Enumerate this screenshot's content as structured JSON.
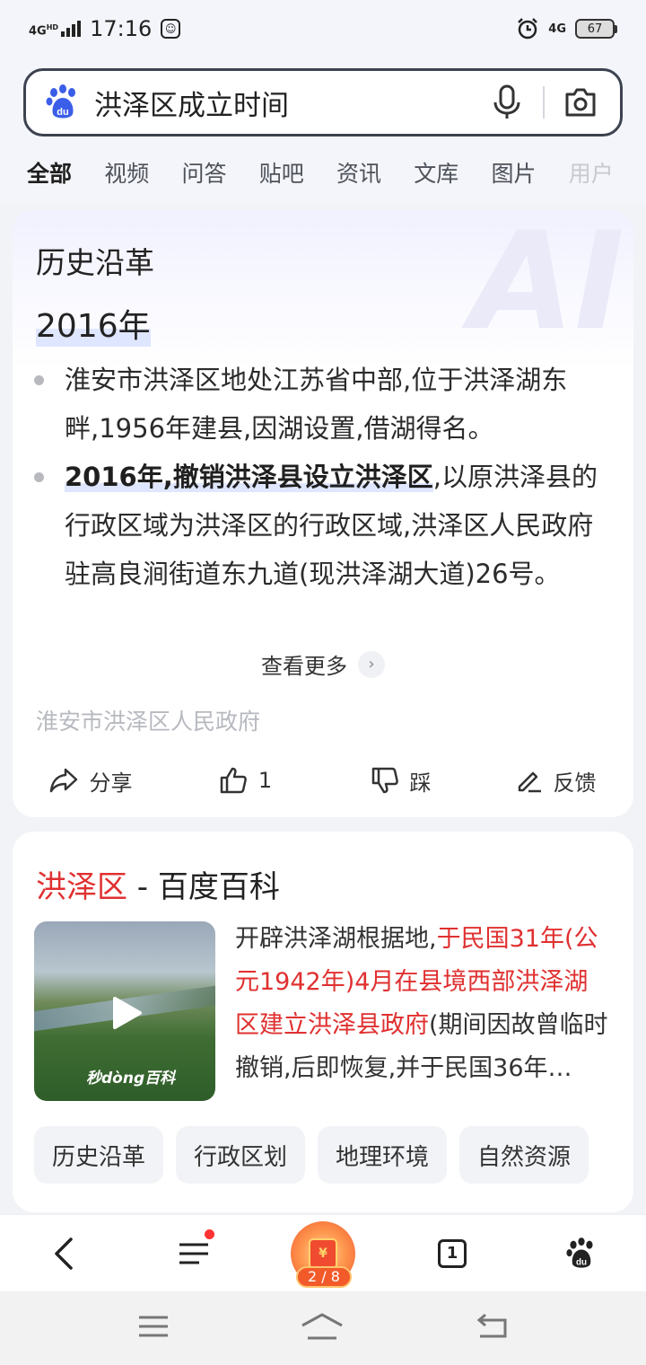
{
  "status_bar": {
    "network": "4G",
    "network_sup": "HD",
    "time": "17:16",
    "right_network": "4G",
    "battery": "67"
  },
  "search": {
    "query": "洪泽区成立时间"
  },
  "tabs": [
    "全部",
    "视频",
    "问答",
    "贴吧",
    "资讯",
    "文库",
    "图片",
    "用户"
  ],
  "ai_card": {
    "watermark": "AI",
    "title": "历史沿革",
    "year": "2016年",
    "bullet1": "淮安市洪泽区地处江苏省中部,位于洪泽湖东畔,1956年建县,因湖设置,借湖得名。",
    "bullet2_highlight": "2016年,撤销洪泽县设立洪泽区",
    "bullet2_rest": ",以原洪泽县的行政区域为洪泽区的行政区域,洪泽区人民政府驻高良涧街道东九道(现洪泽湖大道)26号。",
    "more": "查看更多",
    "source": "淮安市洪泽区人民政府",
    "actions": {
      "share": "分享",
      "like_count": "1",
      "dislike": "踩",
      "feedback": "反馈"
    }
  },
  "baike_card": {
    "title_red": "洪泽区",
    "title_rest": " - 百度百科",
    "thumb_logo": "秒dòng百科",
    "text_plain1": "开辟洪泽湖根据地,",
    "text_red": "于民国31年(公元1942年)4月在县境西部洪泽湖区建立洪泽县政府",
    "text_plain2": "(期间因故曾临时撤销,后即恢复,并于民国36年…",
    "chips": [
      "历史沿革",
      "行政区划",
      "地理环境",
      "自然资源"
    ]
  },
  "bottom_bar": {
    "reward_count": "2 / 8",
    "reward_symbol": "¥",
    "tab_count": "1"
  }
}
